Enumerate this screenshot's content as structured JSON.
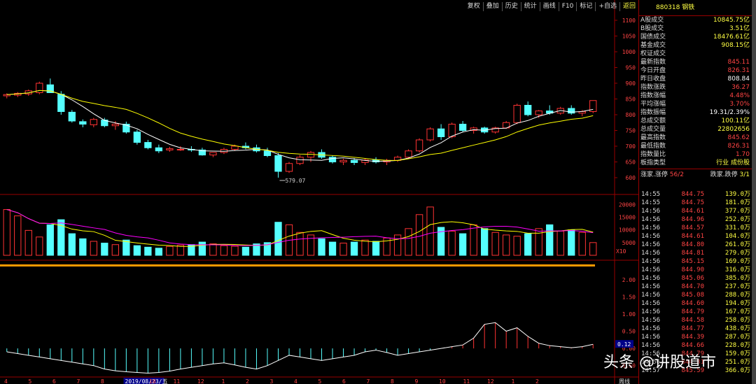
{
  "toolbar": [
    "复权",
    "叠加",
    "历史",
    "统计",
    "画线",
    "F10",
    "标记",
    "+自选",
    "返回"
  ],
  "header": {
    "code": "880318",
    "name": "钢铁"
  },
  "stats": [
    {
      "label": "A股成交",
      "value": "10845.75亿",
      "color": "yellow"
    },
    {
      "label": "B股成交",
      "value": "3.51亿",
      "color": "yellow"
    },
    {
      "label": "国债成交",
      "value": "18476.61亿",
      "color": "yellow"
    },
    {
      "label": "基金成交",
      "value": "908.15亿",
      "color": "yellow"
    },
    {
      "label": "权证成交",
      "value": "",
      "color": "yellow"
    },
    {
      "label": "最新指数",
      "value": "845.11",
      "color": "red"
    },
    {
      "label": "今日开盘",
      "value": "826.31",
      "color": "red"
    },
    {
      "label": "昨日收盘",
      "value": "808.84",
      "color": "white"
    },
    {
      "label": "指数涨跌",
      "value": "36.27",
      "color": "red"
    },
    {
      "label": "指数涨幅",
      "value": "4.48%",
      "color": "red"
    },
    {
      "label": "平均涨幅",
      "value": "3.70%",
      "color": "red"
    },
    {
      "label": "指数振幅",
      "value": "19.31/2.39%",
      "color": "white"
    },
    {
      "label": "总成交额",
      "value": "100.11亿",
      "color": "yellow"
    },
    {
      "label": "总成交量",
      "value": "22802656",
      "color": "yellow"
    },
    {
      "label": "最高指数",
      "value": "845.62",
      "color": "red"
    },
    {
      "label": "最低指数",
      "value": "826.31",
      "color": "red"
    },
    {
      "label": "指数量比",
      "value": "1.70",
      "color": "red"
    },
    {
      "label": "板指类型",
      "value": "行业 成份股",
      "color": "yellow"
    }
  ],
  "rise_fall": {
    "rise_label": "涨家.涨停",
    "rise_value": "56/2",
    "fall_label": "跌家.跌停",
    "fall_value": "3/1"
  },
  "trades": [
    {
      "time": "14:55",
      "price": "844.75",
      "vol": "139.0万"
    },
    {
      "time": "14:55",
      "price": "844.75",
      "vol": "181.0万"
    },
    {
      "time": "14:56",
      "price": "844.61",
      "vol": "377.0万"
    },
    {
      "time": "14:56",
      "price": "844.96",
      "vol": "252.0万"
    },
    {
      "time": "14:56",
      "price": "844.57",
      "vol": "331.0万"
    },
    {
      "time": "14:56",
      "price": "844.61",
      "vol": "104.0万"
    },
    {
      "time": "14:56",
      "price": "844.80",
      "vol": "261.0万"
    },
    {
      "time": "14:56",
      "price": "844.81",
      "vol": "279.0万"
    },
    {
      "time": "14:56",
      "price": "845.15",
      "vol": "169.0万"
    },
    {
      "time": "14:56",
      "price": "844.90",
      "vol": "316.0万"
    },
    {
      "time": "14:56",
      "price": "845.06",
      "vol": "385.0万"
    },
    {
      "time": "14:56",
      "price": "844.70",
      "vol": "237.0万"
    },
    {
      "time": "14:56",
      "price": "845.08",
      "vol": "288.0万"
    },
    {
      "time": "14:56",
      "price": "844.60",
      "vol": "194.0万"
    },
    {
      "time": "14:56",
      "price": "844.79",
      "vol": "167.0万"
    },
    {
      "time": "14:56",
      "price": "844.58",
      "vol": "258.0万"
    },
    {
      "time": "14:56",
      "price": "844.77",
      "vol": "438.0万"
    },
    {
      "time": "14:56",
      "price": "844.39",
      "vol": "287.0万"
    },
    {
      "time": "14:56",
      "price": "844.66",
      "vol": "228.0万"
    },
    {
      "time": "14:56",
      "price": "844.79",
      "vol": "159.0万"
    },
    {
      "time": "14:56",
      "price": "844.81",
      "vol": "251.0万"
    },
    {
      "time": "14:57",
      "price": "845.59",
      "vol": "366.0万"
    }
  ],
  "price_axis": [
    "1100",
    "1050",
    "1000",
    "950",
    "900",
    "850",
    "800",
    "750",
    "700",
    "650",
    "600"
  ],
  "volume_axis": [
    "20000",
    "15000",
    "10000",
    "5000"
  ],
  "volume_unit": "X10",
  "osc_axis": [
    "2.00",
    "1.50",
    "1.00",
    "0.50",
    "0.00",
    "-0.50"
  ],
  "osc_current": "0.12",
  "low_marker": "579.07",
  "x_labels": [
    "4",
    "5",
    "6",
    "7",
    "8",
    "2019/08/23/五",
    "10",
    "11",
    "12",
    "1",
    "2",
    "3",
    "4",
    "5",
    "6",
    "7",
    "8",
    "9",
    "10",
    "11",
    "12",
    "1",
    "2"
  ],
  "period_label": "周线",
  "watermark": "头条 @讲股道市",
  "chart_data": {
    "type": "candlestick",
    "price": {
      "ylim": [
        560,
        1120
      ],
      "candles": [
        [
          860,
          868,
          852,
          864
        ],
        [
          862,
          872,
          856,
          868
        ],
        [
          866,
          880,
          860,
          876
        ],
        [
          870,
          905,
          865,
          900
        ],
        [
          895,
          915,
          880,
          870
        ],
        [
          865,
          875,
          800,
          810
        ],
        [
          808,
          815,
          775,
          780
        ],
        [
          778,
          785,
          760,
          770
        ],
        [
          768,
          790,
          760,
          785
        ],
        [
          783,
          790,
          760,
          765
        ],
        [
          765,
          780,
          752,
          770
        ],
        [
          770,
          778,
          740,
          745
        ],
        [
          745,
          752,
          705,
          712
        ],
        [
          712,
          720,
          690,
          695
        ],
        [
          695,
          705,
          678,
          685
        ],
        [
          688,
          698,
          682,
          692
        ],
        [
          690,
          700,
          685,
          690
        ],
        [
          690,
          700,
          682,
          688
        ],
        [
          688,
          695,
          670,
          672
        ],
        [
          672,
          680,
          665,
          680
        ],
        [
          680,
          695,
          675,
          690
        ],
        [
          690,
          705,
          685,
          700
        ],
        [
          700,
          712,
          690,
          695
        ],
        [
          695,
          705,
          680,
          685
        ],
        [
          685,
          695,
          665,
          670
        ],
        [
          670,
          678,
          600,
          620
        ],
        [
          620,
          650,
          615,
          645
        ],
        [
          645,
          672,
          640,
          665
        ],
        [
          665,
          685,
          650,
          680
        ],
        [
          680,
          690,
          660,
          665
        ],
        [
          665,
          670,
          645,
          650
        ],
        [
          650,
          660,
          640,
          655
        ],
        [
          655,
          662,
          640,
          648
        ],
        [
          648,
          660,
          640,
          656
        ],
        [
          656,
          665,
          645,
          650
        ],
        [
          650,
          660,
          640,
          655
        ],
        [
          655,
          670,
          650,
          665
        ],
        [
          665,
          690,
          660,
          685
        ],
        [
          685,
          725,
          680,
          720
        ],
        [
          720,
          760,
          715,
          755
        ],
        [
          755,
          770,
          720,
          730
        ],
        [
          730,
          775,
          725,
          770
        ],
        [
          770,
          780,
          745,
          750
        ],
        [
          750,
          762,
          740,
          758
        ],
        [
          758,
          762,
          740,
          745
        ],
        [
          745,
          762,
          740,
          758
        ],
        [
          758,
          780,
          755,
          775
        ],
        [
          775,
          835,
          770,
          830
        ],
        [
          830,
          842,
          795,
          800
        ],
        [
          800,
          815,
          790,
          812
        ],
        [
          812,
          830,
          800,
          805
        ],
        [
          805,
          825,
          800,
          820
        ],
        [
          820,
          830,
          800,
          805
        ],
        [
          805,
          815,
          795,
          810
        ],
        [
          810,
          845,
          805,
          845
        ]
      ]
    },
    "volume": {
      "ylim": [
        0,
        22000
      ],
      "values": [
        18000,
        15500,
        9800,
        7200,
        12000,
        14000,
        8500,
        6500,
        5500,
        4800,
        4200,
        6000,
        3800,
        3200,
        2800,
        3500,
        4000,
        4200,
        5200,
        4500,
        3800,
        3600,
        3200,
        4500,
        5000,
        13000,
        12000,
        9000,
        8000,
        6500,
        5200,
        4800,
        5200,
        6000,
        5500,
        6800,
        8000,
        10500,
        16000,
        19000,
        11000,
        9500,
        8500,
        12000,
        10500,
        9000,
        8000,
        7500,
        8500,
        10500,
        12000,
        9500,
        10000,
        9000,
        5000
      ]
    },
    "oscillator": {
      "ylim": [
        -0.75,
        2.3
      ],
      "values": [
        -0.1,
        -0.15,
        -0.2,
        -0.25,
        -0.3,
        -0.35,
        -0.4,
        -0.45,
        -0.5,
        -0.6,
        -0.65,
        -0.68,
        -0.7,
        -0.72,
        -0.7,
        -0.66,
        -0.6,
        -0.55,
        -0.5,
        -0.45,
        -0.42,
        -0.48,
        -0.55,
        -0.6,
        -0.5,
        -0.35,
        -0.2,
        -0.25,
        -0.3,
        -0.35,
        -0.3,
        -0.25,
        -0.2,
        -0.1,
        -0.05,
        -0.12,
        -0.2,
        -0.15,
        -0.1,
        -0.05,
        0.0,
        0.05,
        0.1,
        0.3,
        0.7,
        0.75,
        0.5,
        0.6,
        0.35,
        0.15,
        0.08,
        0.05,
        0.02,
        0.05,
        0.12
      ]
    }
  }
}
